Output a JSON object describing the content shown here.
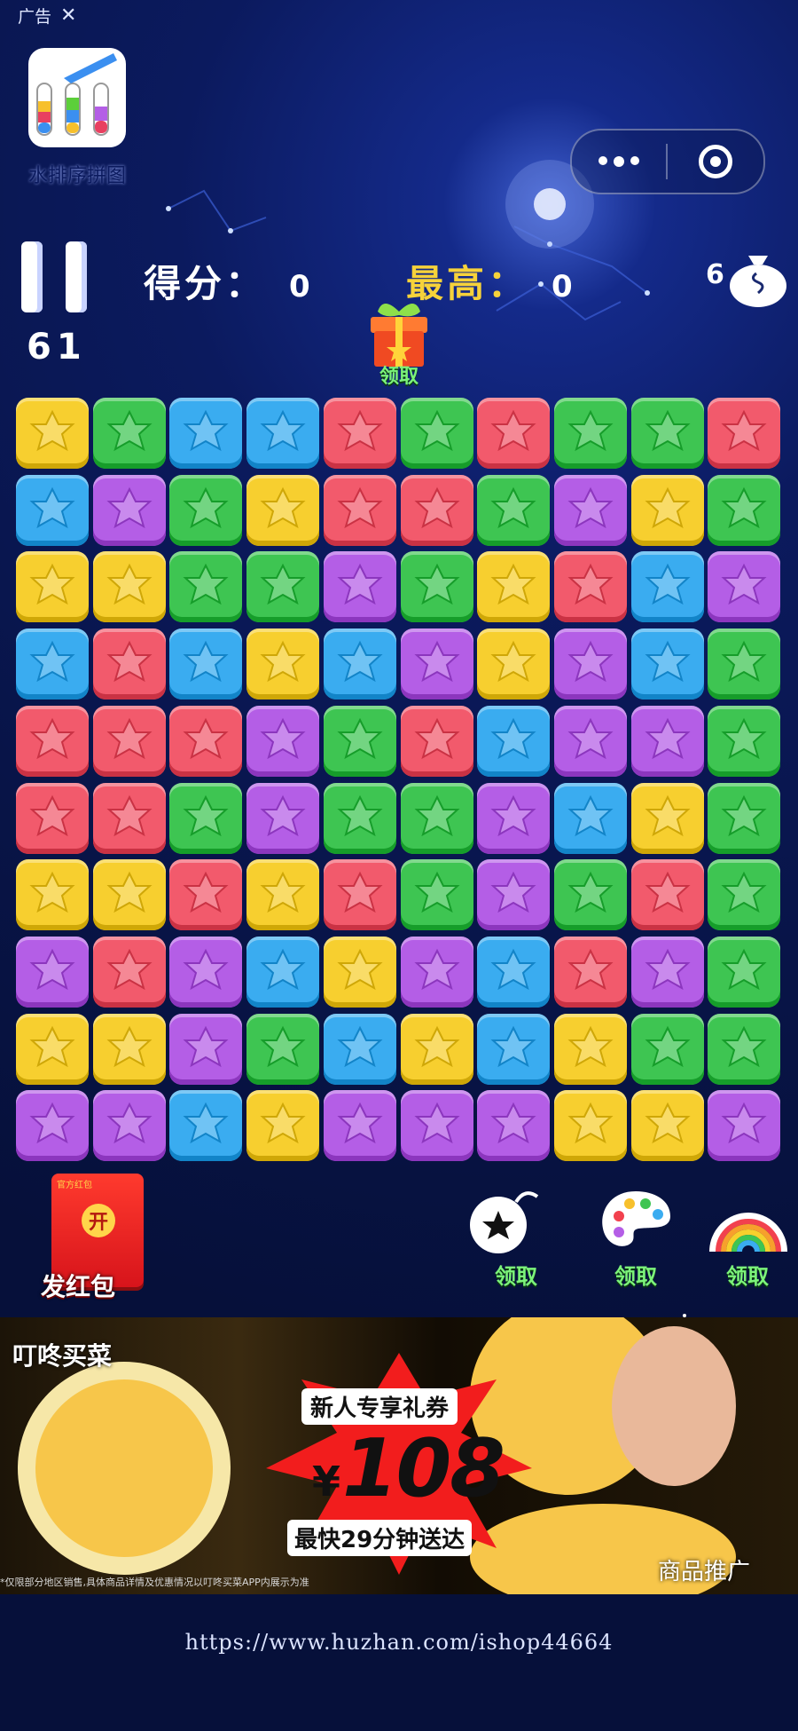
{
  "ad_tag": {
    "label": "广告",
    "close": "✕"
  },
  "app": {
    "name": "水排序拼图",
    "icon": "water-sort-tubes-icon"
  },
  "capsule": {
    "more_icon": "more-dots-icon",
    "close_icon": "target-circle-icon"
  },
  "hud": {
    "score_label": "得分：",
    "score_value": "0",
    "best_label": "最高：",
    "best_value": "0",
    "level": "61",
    "bag_count": "6",
    "gift_label": "领取"
  },
  "board": {
    "rows": 10,
    "cols": 10,
    "colors": {
      "Y": "#f7cf2f",
      "G": "#3ec552",
      "B": "#3aacf0",
      "R": "#f25a6c",
      "P": "#b45ee6"
    },
    "grid": [
      [
        "Y",
        "G",
        "B",
        "B",
        "R",
        "G",
        "R",
        "G",
        "G",
        "R"
      ],
      [
        "B",
        "P",
        "G",
        "Y",
        "R",
        "R",
        "G",
        "P",
        "Y",
        "G"
      ],
      [
        "Y",
        "Y",
        "G",
        "G",
        "P",
        "G",
        "Y",
        "R",
        "B",
        "P"
      ],
      [
        "B",
        "R",
        "B",
        "Y",
        "B",
        "P",
        "Y",
        "P",
        "B",
        "G"
      ],
      [
        "R",
        "R",
        "R",
        "P",
        "G",
        "R",
        "B",
        "P",
        "P",
        "G"
      ],
      [
        "R",
        "R",
        "G",
        "P",
        "G",
        "G",
        "P",
        "B",
        "Y",
        "G"
      ],
      [
        "Y",
        "Y",
        "R",
        "Y",
        "R",
        "G",
        "P",
        "G",
        "R",
        "G"
      ],
      [
        "P",
        "R",
        "P",
        "B",
        "Y",
        "P",
        "B",
        "R",
        "P",
        "G"
      ],
      [
        "Y",
        "Y",
        "P",
        "G",
        "B",
        "Y",
        "B",
        "Y",
        "G",
        "G"
      ],
      [
        "P",
        "P",
        "B",
        "Y",
        "P",
        "P",
        "P",
        "Y",
        "Y",
        "P"
      ]
    ]
  },
  "bottom": {
    "hongbao_label": "发红包",
    "hongbao_open": "开",
    "hongbao_tag": "官方红包",
    "tools": [
      {
        "name": "bomb-icon",
        "label": "领取"
      },
      {
        "name": "palette-icon",
        "label": "领取"
      },
      {
        "name": "rainbow-icon",
        "label": "领取"
      }
    ]
  },
  "ad_banner": {
    "brand": "叮咚买菜",
    "headline": "新人专享礼券",
    "currency": "¥",
    "amount": "108",
    "sub": "最快29分钟送达",
    "disclaimer": "*仅限部分地区销售,具体商品详情及优惠情况以叮咚买菜APP内展示为准",
    "promo": "商品推广"
  },
  "watermark": "https://www.huzhan.com/ishop44664"
}
